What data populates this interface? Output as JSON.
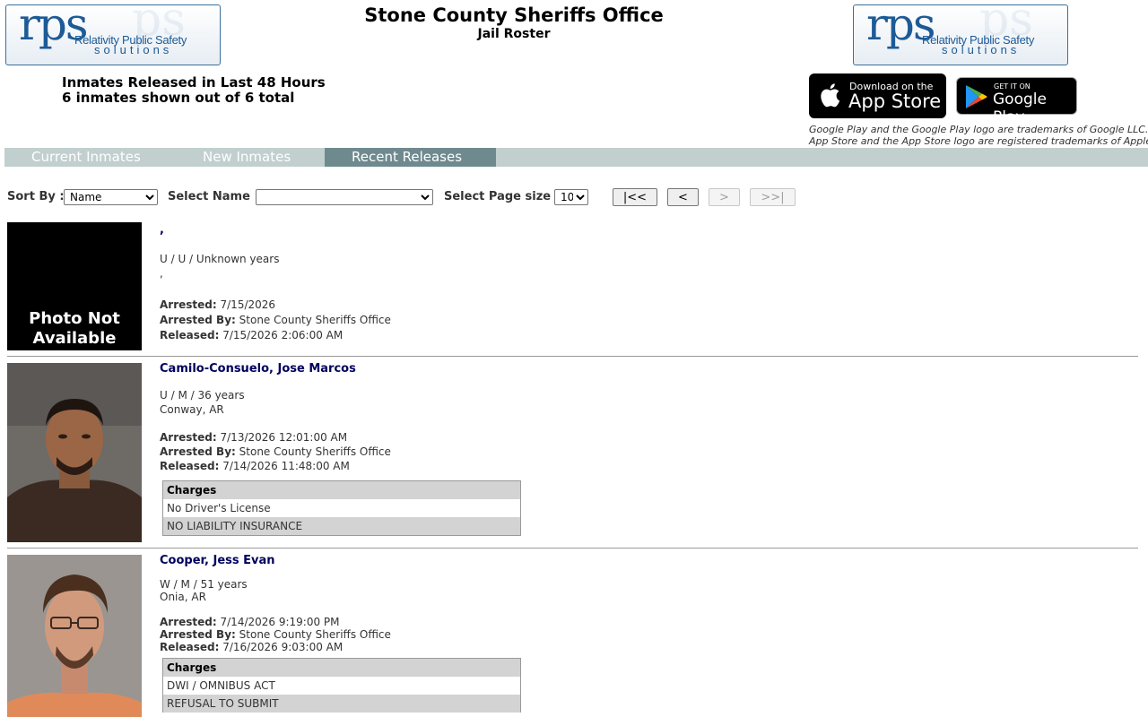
{
  "header": {
    "title": "Stone County Sheriffs Office",
    "subtitle": "Jail Roster",
    "logo": {
      "main": "rps",
      "line1": "Relativity Public Safety",
      "line2": "solutions"
    }
  },
  "summary": {
    "heading": "Inmates Released in Last 48 Hours",
    "count": "6 inmates shown out of 6 total"
  },
  "app_store": {
    "small": "Download on the",
    "big": "App Store"
  },
  "google_play": {
    "small": "GET IT ON",
    "big": "Google Play"
  },
  "trademark": {
    "line1": "Google Play and the Google Play logo are trademarks of Google LLC.",
    "line2": "App Store and the App Store logo are registered trademarks of Apple"
  },
  "tabs": [
    {
      "label": "Current Inmates"
    },
    {
      "label": "New Inmates"
    },
    {
      "label": "Recent Releases"
    }
  ],
  "controls": {
    "sort_label": "Sort By :",
    "sort_value": "Name",
    "name_label": "Select Name :",
    "name_value": "",
    "page_size_label": "Select Page size :",
    "page_size_value": "10",
    "first": "|<<",
    "prev": "<",
    "next": ">",
    "last": ">>|"
  },
  "labels": {
    "arrested": "Arrested:",
    "arrested_by": "Arrested By:",
    "released": "Released:",
    "charges": "Charges",
    "photo_na_1": "Photo Not",
    "photo_na_2": "Available"
  },
  "inmates": [
    {
      "name": ",",
      "demo": "U / U / Unknown years",
      "location": ",",
      "arrested": "7/15/2026",
      "arrested_by": "Stone County Sheriffs Office",
      "released": "7/15/2026 2:06:00 AM",
      "charges": []
    },
    {
      "name": "Camilo-Consuelo, Jose Marcos",
      "demo": "U / M / 36 years",
      "location": "Conway, AR",
      "arrested": "7/13/2026 12:01:00 AM",
      "arrested_by": "Stone County Sheriffs Office",
      "released": "7/14/2026 11:48:00 AM",
      "charges": [
        "No Driver's License",
        "NO LIABILITY INSURANCE"
      ]
    },
    {
      "name": "Cooper, Jess Evan",
      "demo": "W / M / 51 years",
      "location": "Onia, AR",
      "arrested": "7/14/2026 9:19:00 PM",
      "arrested_by": "Stone County Sheriffs Office",
      "released": "7/16/2026 9:03:00 AM",
      "charges": [
        "DWI / OMNIBUS ACT",
        "REFUSAL TO SUBMIT"
      ]
    }
  ]
}
